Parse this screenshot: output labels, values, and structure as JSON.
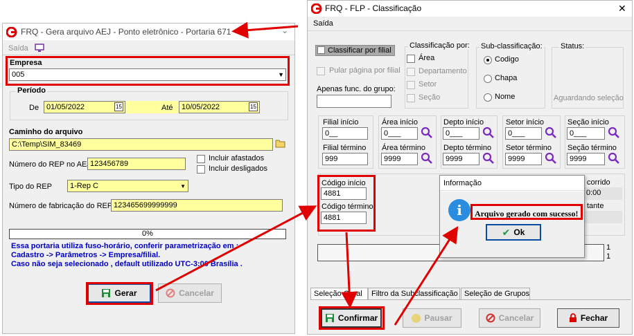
{
  "left": {
    "title": "FRQ - Gera arquivo  AEJ - Ponto eletrônico - Portaria 671",
    "menu_exit": "Saída",
    "empresa_label": "Empresa",
    "empresa_value": "005",
    "periodo_label": "Período",
    "de_label": "De",
    "de_value": "01/05/2022",
    "ate_label": "Até",
    "ate_value": "10/05/2022",
    "caminho_label": "Caminho do arquivo",
    "caminho_value": "C:\\Temp\\SIM_83469",
    "rep_aej_label": "Número do REP no AEJ",
    "rep_aej_value": "123456789",
    "incluir_afastados": "Incluir afastados",
    "incluir_desligados": "Incluir desligados",
    "tipo_rep_label": "Tipo do REP",
    "tipo_rep_value": "1-Rep C",
    "fabricacao_label": "Número de fabricação do REP",
    "fabricacao_value": "123465699999999",
    "progress_text": "0%",
    "progress": 0,
    "note_line1": "Essa portaria utiliza fuso-horário, conferir parametrização em :",
    "note_line2": "Cadastro -> Parâmetros -> Empresa/filial.",
    "note_line3": "Caso não seja selecionado , default utilizado UTC-3:00 Brasília .",
    "gerar_label": "Gerar",
    "cancelar_label": "Cancelar"
  },
  "right": {
    "title": "FRQ - FLP - Classificação",
    "menu_exit": "Saída",
    "classificar_por_filial": "Classificar por filial",
    "pular_pagina": "Pular página por filial",
    "apenas_func_label": "Apenas func. do grupo:",
    "classificacao_por": "Classificação  por:",
    "area": "Área",
    "departamento": "Departamento",
    "setor": "Setor",
    "secao": "Seção",
    "subclassificacao": "Sub-classificação:",
    "codigo": "Codigo",
    "chapa": "Chapa",
    "nome": "Nome",
    "status_label": "Status:",
    "status_value": "Aguardando seleção",
    "filial_inicio": "Filial início",
    "filial_inicio_value": "0__",
    "filial_termino": "Filial término",
    "filial_termino_value": "999",
    "area_inicio": "Área início",
    "area_inicio_value": "0___",
    "area_termino": "Área término",
    "area_termino_value": "9999",
    "depto_inicio": "Depto início",
    "depto_inicio_value": "0___",
    "depto_termino": "Depto término",
    "depto_termino_value": "9999",
    "setor_inicio": "Setor início",
    "setor_inicio_value": "0___",
    "setor_termino": "Setor término",
    "setor_termino_value": "9999",
    "secao_inicio": "Seção início",
    "secao_inicio_value": "0___",
    "secao_termino": "Seção término",
    "secao_termino_value": "9999",
    "codigo_inicio": "Código início",
    "codigo_inicio_value": "4881",
    "codigo_termino": "Código término",
    "codigo_termino_value": "4881",
    "corrido_partial": "corrido",
    "tempo_partial": "0:00",
    "tante_partial": "tante",
    "count1": "1",
    "count2": "1",
    "tab1": "Seleção Geral",
    "tab2": "Filtro da Subclassificação",
    "tab3": "Seleção de Grupos",
    "confirmar_label": "Confirmar",
    "pausar_label": "Pausar",
    "cancelar_label": "Cancelar",
    "fechar_label": "Fechar"
  },
  "dialog": {
    "title": "Informação",
    "message": "Arquivo gerado com sucesso!",
    "ok_label": "Ok"
  },
  "colors": {
    "highlight_red": "#e00000",
    "field_yellow": "#ffff9e",
    "info_blue": "#2b8de0",
    "note_blue": "#0000cc"
  }
}
